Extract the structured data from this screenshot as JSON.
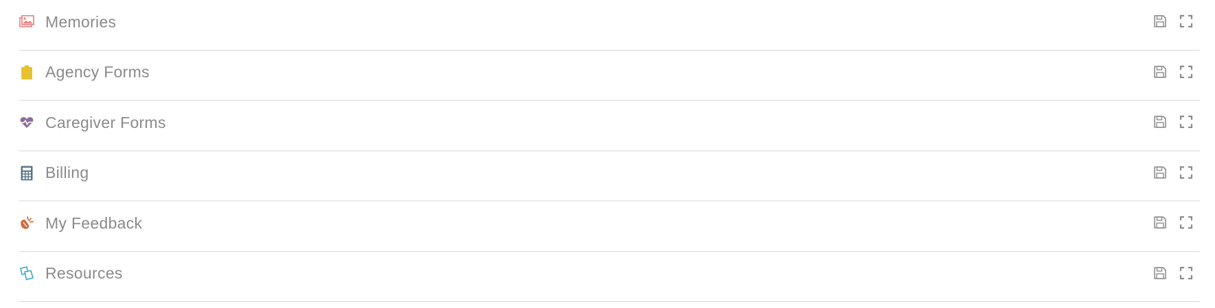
{
  "panels": [
    {
      "title": "Memories",
      "icon": "image-icon",
      "icon_color": "#e77d7d"
    },
    {
      "title": "Agency Forms",
      "icon": "clipboard-icon",
      "icon_color": "#e8c22e"
    },
    {
      "title": "Caregiver Forms",
      "icon": "heartbeat-icon",
      "icon_color": "#8e6d98"
    },
    {
      "title": "Billing",
      "icon": "calculator-icon",
      "icon_color": "#5b7487"
    },
    {
      "title": "My Feedback",
      "icon": "feedback-icon",
      "icon_color": "#cc7040"
    },
    {
      "title": "Resources",
      "icon": "documents-icon",
      "icon_color": "#3aa6c5"
    }
  ],
  "actions": {
    "save_icon": "save-icon",
    "expand_icon": "expand-icon",
    "icon_color": "#8c8c8c"
  },
  "colors": {
    "divider": "#d9d9d9",
    "title_text": "#8a8a8a"
  }
}
